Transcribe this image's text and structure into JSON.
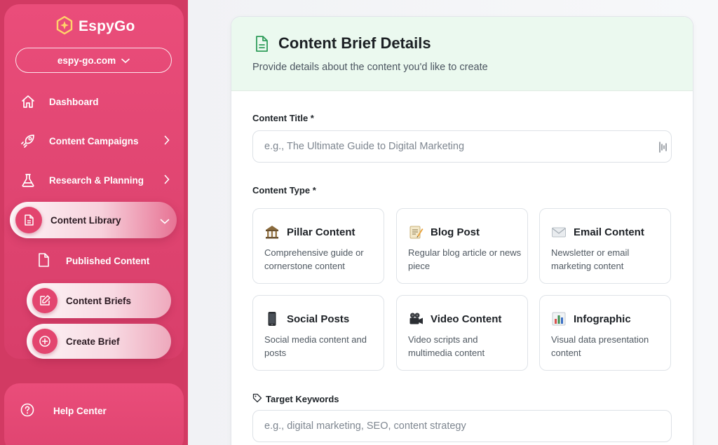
{
  "sidebar": {
    "brand": "EspyGo",
    "domain": "espy-go.com",
    "items": [
      {
        "label": "Dashboard"
      },
      {
        "label": "Content Campaigns"
      },
      {
        "label": "Research & Planning"
      },
      {
        "label": "Content Library"
      }
    ],
    "sub_items": [
      {
        "label": "Published Content"
      },
      {
        "label": "Content Briefs"
      },
      {
        "label": "Create Brief"
      }
    ],
    "help": "Help Center",
    "accent_color": "#e3456f"
  },
  "form": {
    "title": "Content Brief Details",
    "subtitle": "Provide details about the content you'd like to create",
    "content_title_label": "Content Title *",
    "content_title_placeholder": "e.g., The Ultimate Guide to Digital Marketing",
    "content_type_label": "Content Type *",
    "content_types": [
      {
        "icon": "bank-icon",
        "title": "Pillar Content",
        "desc": "Comprehensive guide or cornerstone content"
      },
      {
        "icon": "memo-icon",
        "title": "Blog Post",
        "desc": "Regular blog article or news piece"
      },
      {
        "icon": "envelope-icon",
        "title": "Email Content",
        "desc": "Newsletter or email marketing content"
      },
      {
        "icon": "mobile-phone-icon",
        "title": "Social Posts",
        "desc": "Social media content and posts"
      },
      {
        "icon": "video-camera-icon",
        "title": "Video Content",
        "desc": "Video scripts and multimedia content"
      },
      {
        "icon": "bar-chart-icon",
        "title": "Infographic",
        "desc": "Visual data presentation content"
      }
    ],
    "keywords_label": "Target Keywords",
    "keywords_placeholder": "e.g., digital marketing, SEO, content strategy"
  }
}
